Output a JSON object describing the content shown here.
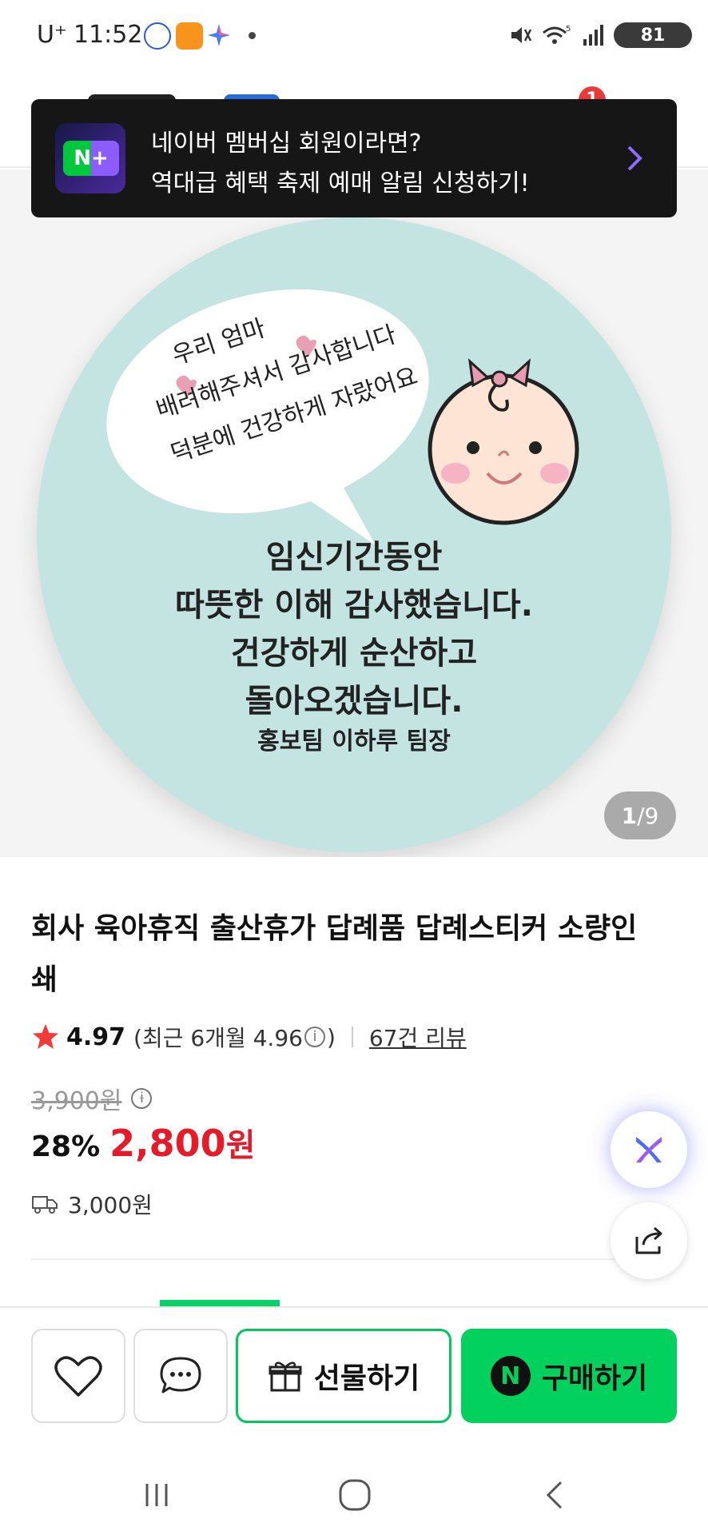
{
  "status_bar": {
    "carrier": "U⁺",
    "time": "11:52",
    "battery": "81"
  },
  "header": {
    "cart_count": "1"
  },
  "toast": {
    "logo_text": "N+",
    "line1": "네이버 멤버십 회원이라면?",
    "line2": "역대급 혜택 축제 예매 알림 신청하기!"
  },
  "product_image": {
    "bubble_lines": [
      "우리 엄마",
      "배려해주셔서 감사합니다",
      "덕분에 건강하게 자랐어요"
    ],
    "main_lines": [
      "임신기간동안",
      "따뜻한 이해 감사했습니다.",
      "건강하게 순산하고",
      "돌아오겠습니다."
    ],
    "signature": "홍보팀 이하루 팀장",
    "page_current": "1",
    "page_total": "/9"
  },
  "product": {
    "title": "회사 육아휴직 출산휴가 답례품 답례스티커 소량인쇄",
    "rating": "4.97",
    "rating_recent": "(최근 6개월 4.96",
    "rating_close": ")",
    "review_link": "67건 리뷰",
    "original_price": "3,900원",
    "discount": "28%",
    "price": "2,800",
    "price_unit": "원",
    "shipping": "3,000원"
  },
  "actions": {
    "gift_label": "선물하기",
    "buy_label": "구매하기",
    "buy_icon_text": "N"
  },
  "colors": {
    "accent_green": "#03d15d",
    "price_red": "#e51b2a",
    "sticker_bg": "#c4e4e1"
  }
}
